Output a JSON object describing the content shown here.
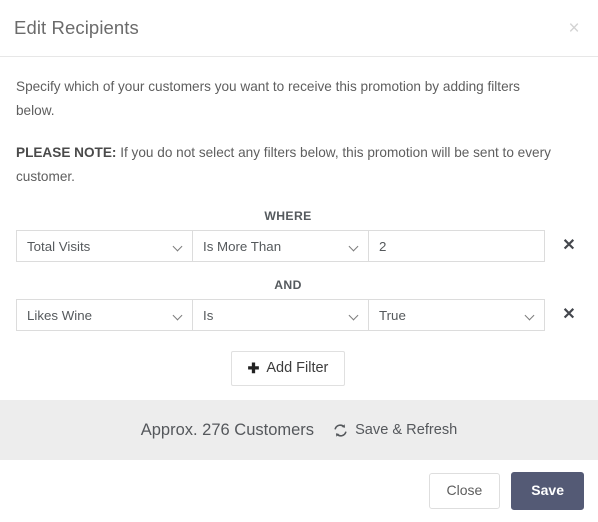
{
  "modal": {
    "title": "Edit Recipients",
    "close_icon": "close-icon",
    "intro": "Specify which of your customers you want to receive this promotion by adding filters below.",
    "note_label": "PLEASE NOTE:",
    "note_text": " If you do not select any filters below, this promotion will be sent to every customer.",
    "filters": [
      {
        "conjunction": "WHERE",
        "field": "Total Visits",
        "operator": "Is More Than",
        "value": "2",
        "value_type": "text",
        "delete_icon": "delete-x-icon"
      },
      {
        "conjunction": "AND",
        "field": "Likes Wine",
        "operator": "Is",
        "value": "True",
        "value_type": "select",
        "delete_icon": "delete-x-icon"
      }
    ],
    "add_filter": {
      "icon": "plus-icon",
      "label": "Add Filter"
    },
    "status": {
      "approx_text": "Approx. 276 Customers",
      "refresh_icon": "sync-icon",
      "refresh_label": "Save & Refresh"
    },
    "footer": {
      "close_label": "Close",
      "save_label": "Save"
    },
    "colors": {
      "save_button": "#545a75",
      "status_bar": "#ededed",
      "title_text": "#6b6b6b"
    }
  }
}
